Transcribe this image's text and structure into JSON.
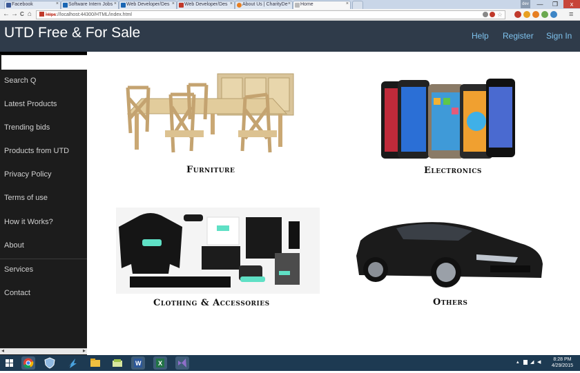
{
  "browser": {
    "tabs": [
      {
        "label": "Facebook",
        "color": "#3b5998"
      },
      {
        "label": "Software Intern Jobs",
        "color": "#1a66b3"
      },
      {
        "label": "Web Developer/Des",
        "color": "#1a66b3"
      },
      {
        "label": "Web Developer/Des",
        "color": "#c0392b"
      },
      {
        "label": "About Us | CharityDe",
        "color": "#e67e22"
      },
      {
        "label": "Home",
        "color": "#999999"
      }
    ],
    "tab_close": "×",
    "url_struck": "https",
    "url_rest": "://localhost:44300/HTML/index.html",
    "window_controls": {
      "user": "dev",
      "minimize": "—",
      "restore": "❐",
      "close": "x"
    },
    "nav_icons": {
      "back": "←",
      "forward": "→",
      "reload": "C",
      "home": "⌂"
    }
  },
  "app": {
    "title": "UTD Free & For Sale",
    "nav": {
      "help": "Help",
      "register": "Register",
      "signin": "Sign In"
    },
    "accent": "#7fc3ee",
    "header_bg": "#2f3b4a"
  },
  "sidebar": {
    "search_value": "",
    "items": [
      "Search Q",
      "Latest Products",
      "Trending bids",
      "Products from UTD",
      "Privacy Policy",
      "Terms of use",
      "How it Works?",
      "About",
      "Services",
      "Contact"
    ],
    "scroll_left": "◂",
    "scroll_right": "▸"
  },
  "categories": {
    "furniture": "Furniture",
    "electronics": "Electronics",
    "clothing": "Clothing & Accessories",
    "others": "Others"
  },
  "taskbar": {
    "time": "8:28 PM",
    "date": "4/29/2015",
    "apps": [
      "windows-start-icon",
      "chrome-icon",
      "security-icon",
      "visual-studio-code-icon",
      "file-explorer-icon",
      "folder-icon",
      "word-icon",
      "excel-icon",
      "visual-studio-icon"
    ]
  }
}
